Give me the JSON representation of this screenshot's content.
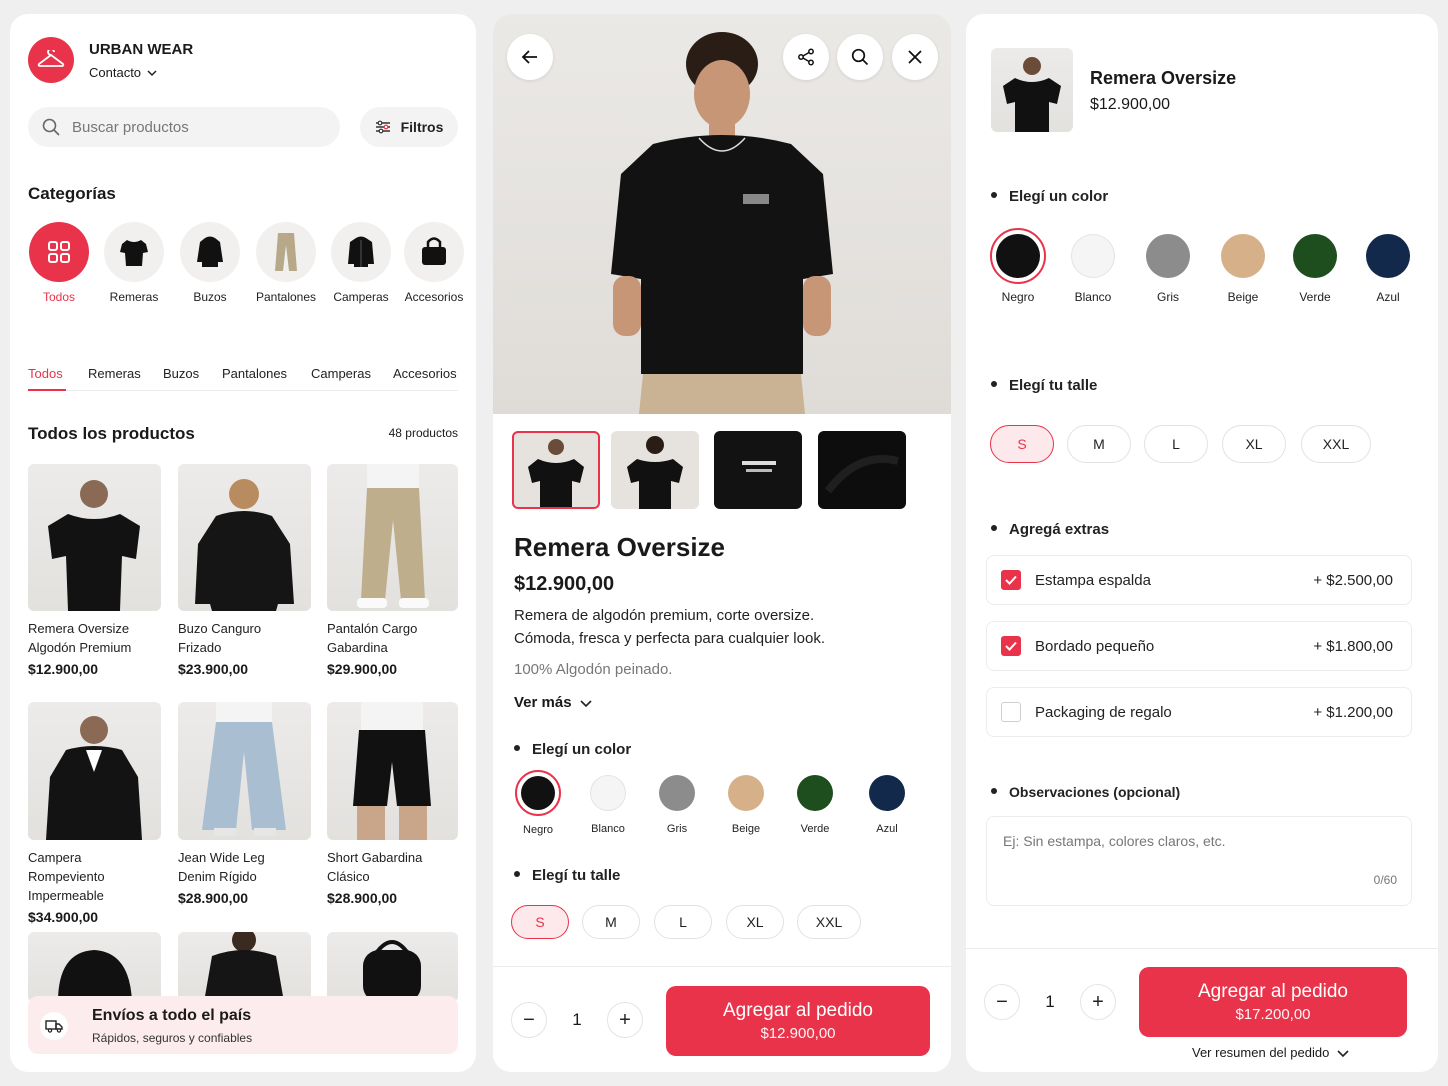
{
  "colors": {
    "accent": "#e8334a",
    "accent_light": "#fde8eb"
  },
  "store": {
    "name": "URBAN WEAR",
    "contact_label": "Contacto",
    "search_placeholder": "Buscar productos",
    "filters_label": "Filtros",
    "categories_title": "Categorías",
    "categories": [
      {
        "label": "Todos",
        "icon": "grid-icon"
      },
      {
        "label": "Remeras",
        "icon": "tshirt"
      },
      {
        "label": "Buzos",
        "icon": "hoodie"
      },
      {
        "label": "Pantalones",
        "icon": "pants"
      },
      {
        "label": "Camperas",
        "icon": "jacket"
      },
      {
        "label": "Accesorios",
        "icon": "bag"
      }
    ],
    "tabs": [
      "Todos",
      "Remeras",
      "Buzos",
      "Pantalones",
      "Camperas",
      "Accesorios"
    ],
    "products_title": "Todos los productos",
    "products_count": "48 productos",
    "products": [
      {
        "name1": "Remera Oversize",
        "name2": "Algodón Premium",
        "price": "$12.900,00"
      },
      {
        "name1": "Buzo Canguro",
        "name2": "Frizado",
        "price": "$23.900,00"
      },
      {
        "name1": "Pantalón Cargo",
        "name2": "Gabardina",
        "price": "$29.900,00"
      },
      {
        "name1": "Campera Rompeviento",
        "name2": "Impermeable",
        "price": "$34.900,00"
      },
      {
        "name1": "Jean Wide Leg",
        "name2": "Denim Rígido",
        "price": "$28.900,00"
      },
      {
        "name1": "Short Gabardina",
        "name2": "Clásico",
        "price": "$28.900,00"
      }
    ],
    "shipping_title": "Envíos a todo el país",
    "shipping_sub": "Rápidos, seguros y confiables"
  },
  "detail": {
    "title": "Remera Oversize",
    "price": "$12.900,00",
    "desc1": "Remera de algodón premium, corte oversize.",
    "desc2": "Cómoda, fresca y perfecta para cualquier look.",
    "material": "100% Algodón peinado.",
    "see_more": "Ver más",
    "color_title": "Elegí un color",
    "size_title": "Elegí tu talle",
    "colors": [
      {
        "label": "Negro",
        "hex": "#111111"
      },
      {
        "label": "Blanco",
        "hex": "#f5f5f5"
      },
      {
        "label": "Gris",
        "hex": "#8c8c8c"
      },
      {
        "label": "Beige",
        "hex": "#d6b088"
      },
      {
        "label": "Verde",
        "hex": "#1e4d1e"
      },
      {
        "label": "Azul",
        "hex": "#13294b"
      }
    ],
    "sizes": [
      "S",
      "M",
      "L",
      "XL",
      "XXL"
    ],
    "quantity": "1",
    "cta_label": "Agregar al pedido",
    "cta_price": "$12.900,00"
  },
  "config": {
    "title": "Remera Oversize",
    "price": "$12.900,00",
    "color_title": "Elegí un color",
    "size_title": "Elegí tu talle",
    "extras_title": "Agregá extras",
    "extras": [
      {
        "label": "Estampa espalda",
        "price": "+ $2.500,00",
        "checked": true
      },
      {
        "label": "Bordado pequeño",
        "price": "+ $1.800,00",
        "checked": true
      },
      {
        "label": "Packaging de regalo",
        "price": "+ $1.200,00",
        "checked": false
      }
    ],
    "notes_title": "Observaciones (opcional)",
    "notes_placeholder": "Ej: Sin estampa, colores claros, etc.",
    "notes_counter": "0/60",
    "quantity": "1",
    "cta_label": "Agregar al pedido",
    "cta_price": "$17.200,00",
    "summary_link": "Ver resumen del pedido"
  }
}
